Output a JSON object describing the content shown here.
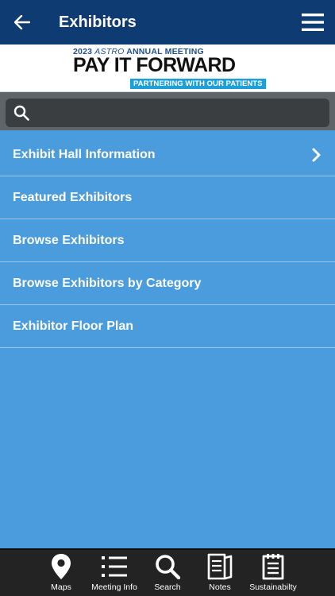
{
  "header": {
    "title": "Exhibitors",
    "back_icon": "arrow-left-icon",
    "menu_icon": "hamburger-menu-icon",
    "background": "#0f3b73"
  },
  "banner": {
    "year": "2023",
    "org": "ASTRO",
    "meeting": "ANNUAL MEETING",
    "headline": "PAY IT FORWARD",
    "tagline": "PARTNERING WITH OUR PATIENTS"
  },
  "search": {
    "placeholder": "",
    "value": "",
    "icon": "search-icon"
  },
  "menu_items": [
    {
      "label": "Exhibit Hall Information",
      "has_chevron": true
    },
    {
      "label": "Featured Exhibitors",
      "has_chevron": false
    },
    {
      "label": "Browse Exhibitors",
      "has_chevron": false
    },
    {
      "label": "Browse Exhibitors by Category",
      "has_chevron": false
    },
    {
      "label": "Exhibitor Floor Plan",
      "has_chevron": false
    }
  ],
  "bottom_tabs": [
    {
      "label": "Maps",
      "icon": "map-pin-icon"
    },
    {
      "label": "Meeting Info",
      "icon": "list-icon"
    },
    {
      "label": "Search",
      "icon": "search-icon"
    },
    {
      "label": "Notes",
      "icon": "notes-icon"
    },
    {
      "label": "Sustainabilty",
      "icon": "clipboard-icon"
    }
  ],
  "colors": {
    "content_background": "#4b9cdc",
    "divider": "#9cc6ea",
    "bottom_bar": "#232323",
    "search_area": "#5f6468",
    "accent": "#1f9fd8"
  }
}
